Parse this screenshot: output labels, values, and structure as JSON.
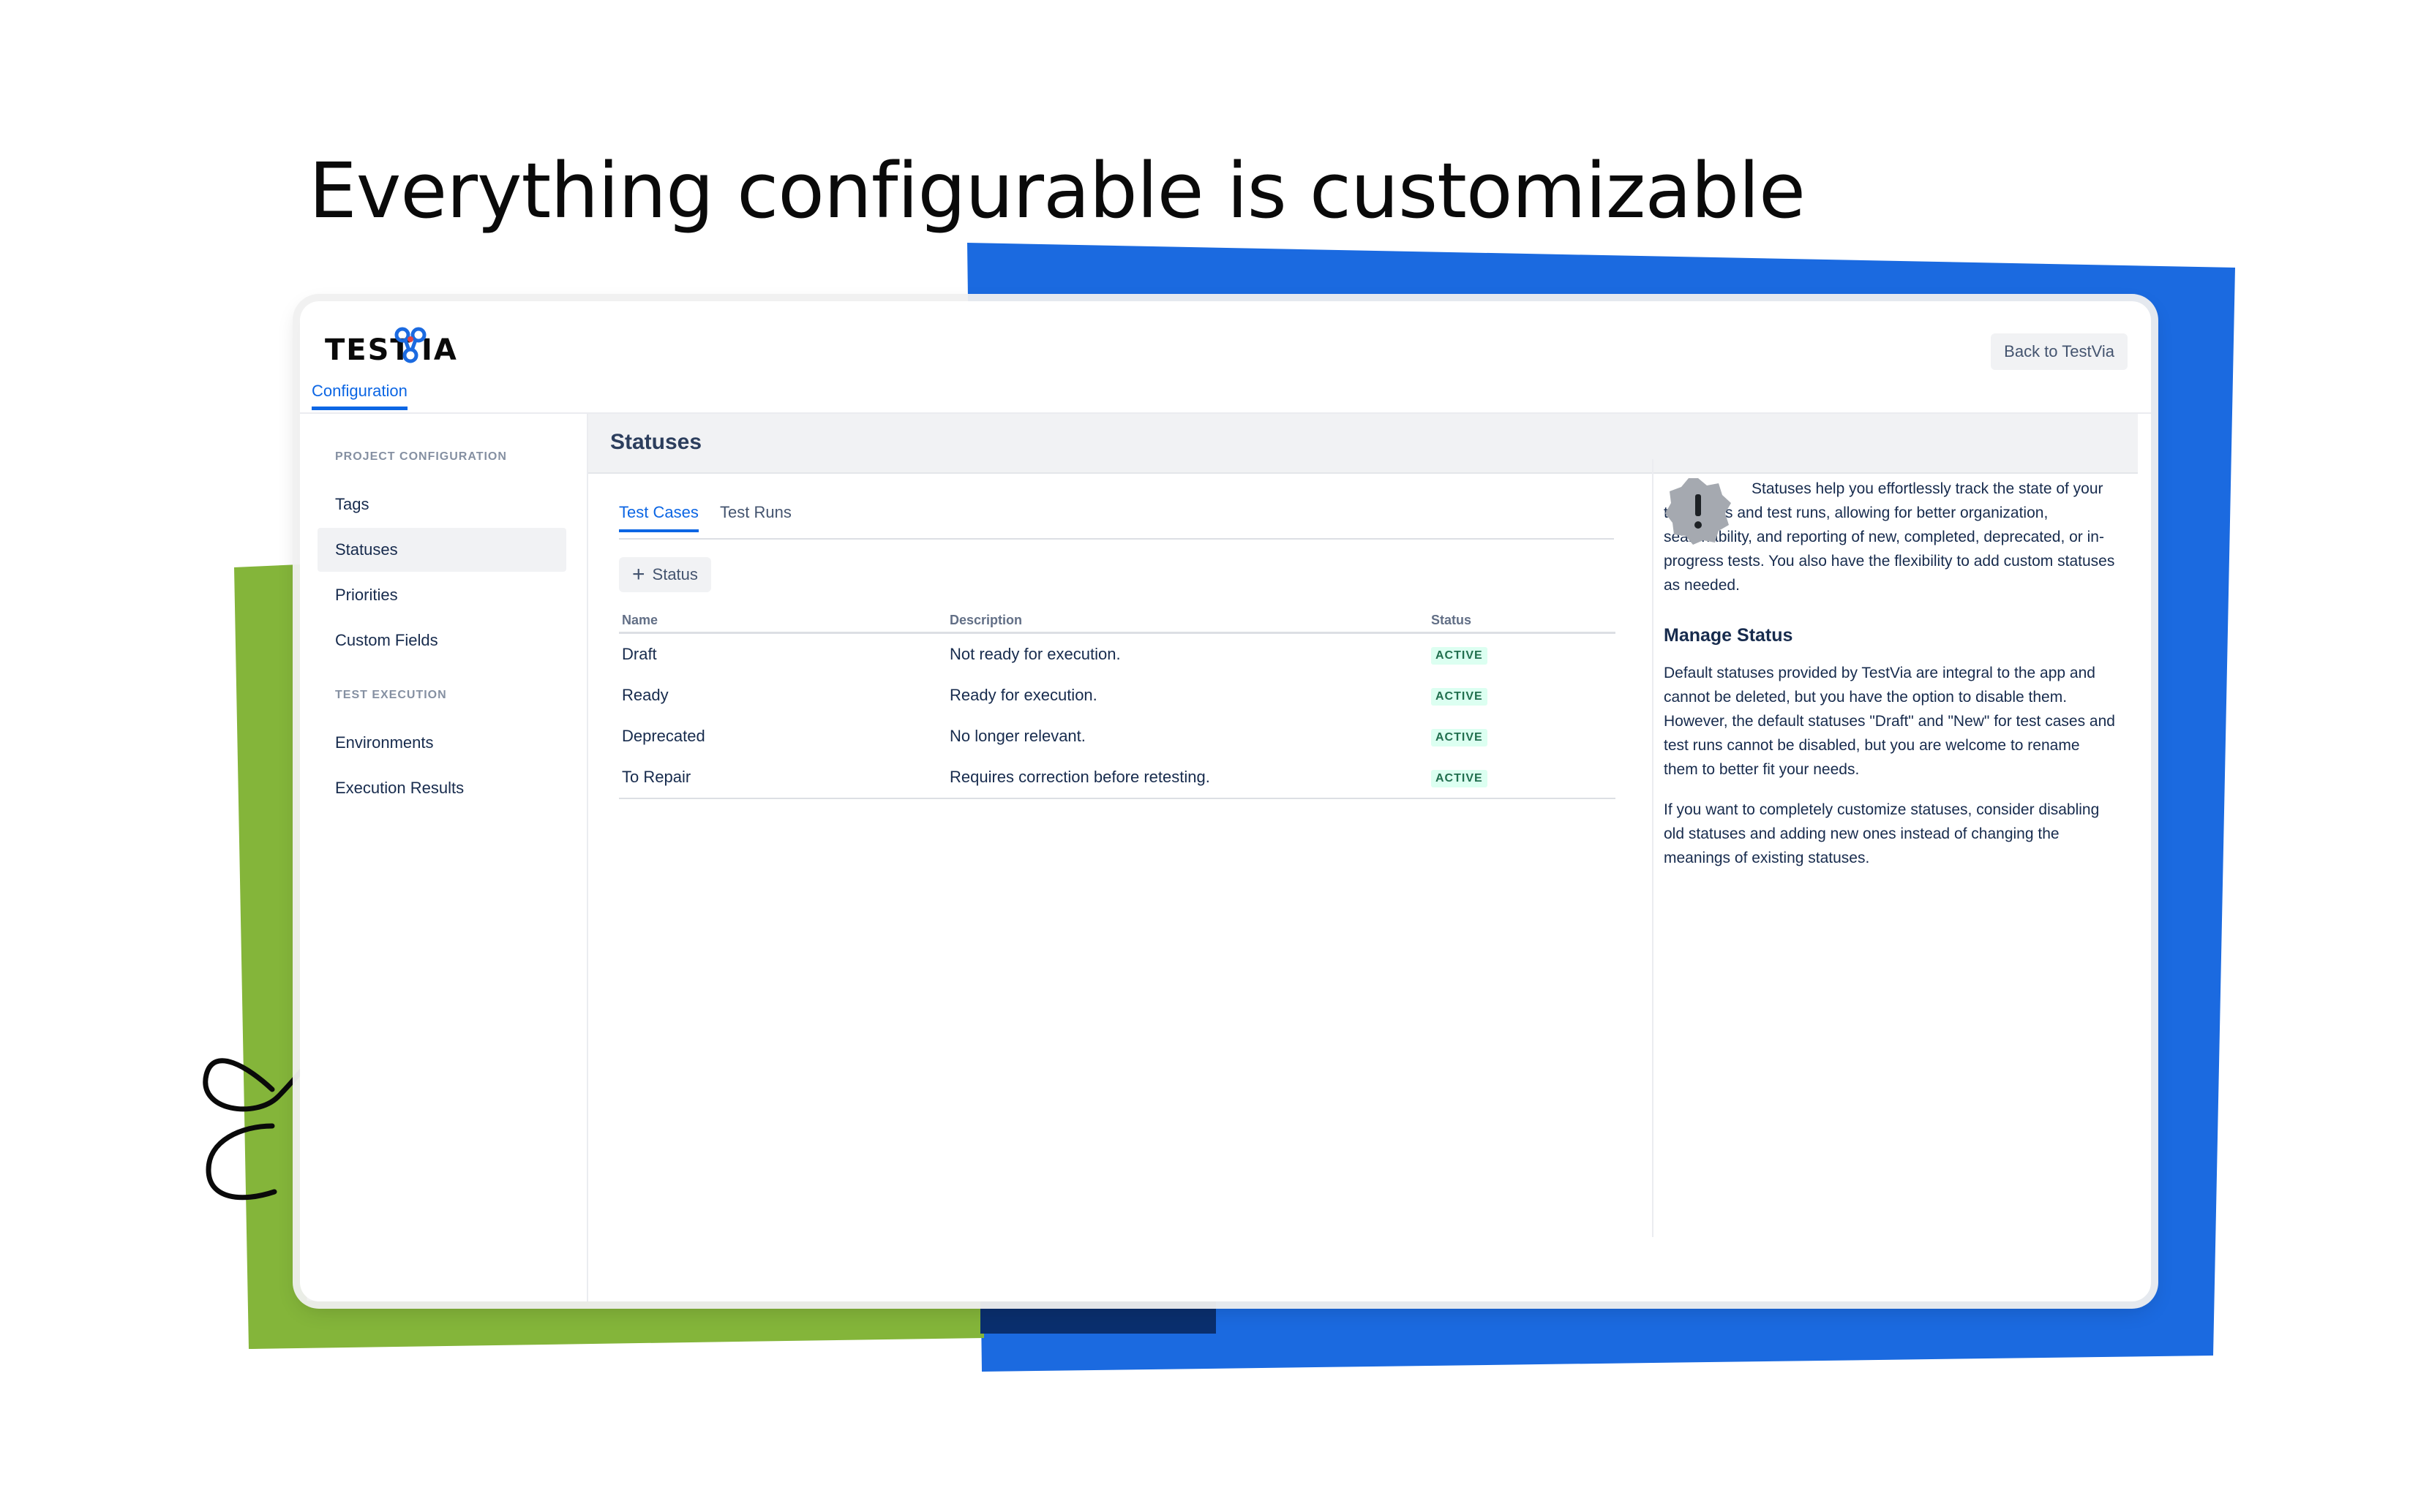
{
  "headline": "Everything configurable is customizable",
  "app": {
    "logo_text": "TESTVIA",
    "config_link": "Configuration",
    "back_button": "Back to TestVia"
  },
  "sidebar": {
    "sections": [
      {
        "title": "PROJECT CONFIGURATION",
        "items": [
          "Tags",
          "Statuses",
          "Priorities",
          "Custom Fields"
        ]
      },
      {
        "title": "TEST EXECUTION",
        "items": [
          "Environments",
          "Execution Results"
        ]
      }
    ],
    "active_item": "Statuses"
  },
  "main": {
    "title": "Statuses",
    "tabs": [
      {
        "label": "Test Cases",
        "active": true
      },
      {
        "label": "Test Runs",
        "active": false
      }
    ],
    "add_button": "Status",
    "table": {
      "headers": [
        "Name",
        "Description",
        "Status"
      ],
      "rows": [
        {
          "name": "Draft",
          "description": "Not ready for execution.",
          "status": "ACTIVE"
        },
        {
          "name": "Ready",
          "description": "Ready for execution.",
          "status": "ACTIVE"
        },
        {
          "name": "Deprecated",
          "description": "No longer relevant.",
          "status": "ACTIVE"
        },
        {
          "name": "To Repair",
          "description": "Requires correction before retesting.",
          "status": "ACTIVE"
        }
      ]
    }
  },
  "info": {
    "icon": "exclamation-badge-icon",
    "intro": "Statuses help you effortlessly track the state of your test cases and test runs, allowing for better organization, searchability, and reporting of new, completed, deprecated, or in-progress tests. You also have the flexibility to add custom statuses as needed.",
    "heading": "Manage Status",
    "paragraph1": "Default statuses provided by TestVia are integral to the app and cannot be deleted, but you have the option to disable them. However, the default statuses \"Draft\" and \"New\" for test cases and test runs cannot be disabled, but you are welcome to rename them to better fit your needs.",
    "paragraph2": "If you want to completely customize statuses, consider disabling old statuses and adding new ones instead of changing the meanings of existing statuses."
  },
  "colors": {
    "accent": "#0c66e4",
    "deco_blue": "#1b6ae0",
    "deco_green": "#84b53a",
    "deco_navy": "#0a2f6e",
    "badge_bg": "#dcfff1",
    "badge_text": "#216e4e"
  }
}
